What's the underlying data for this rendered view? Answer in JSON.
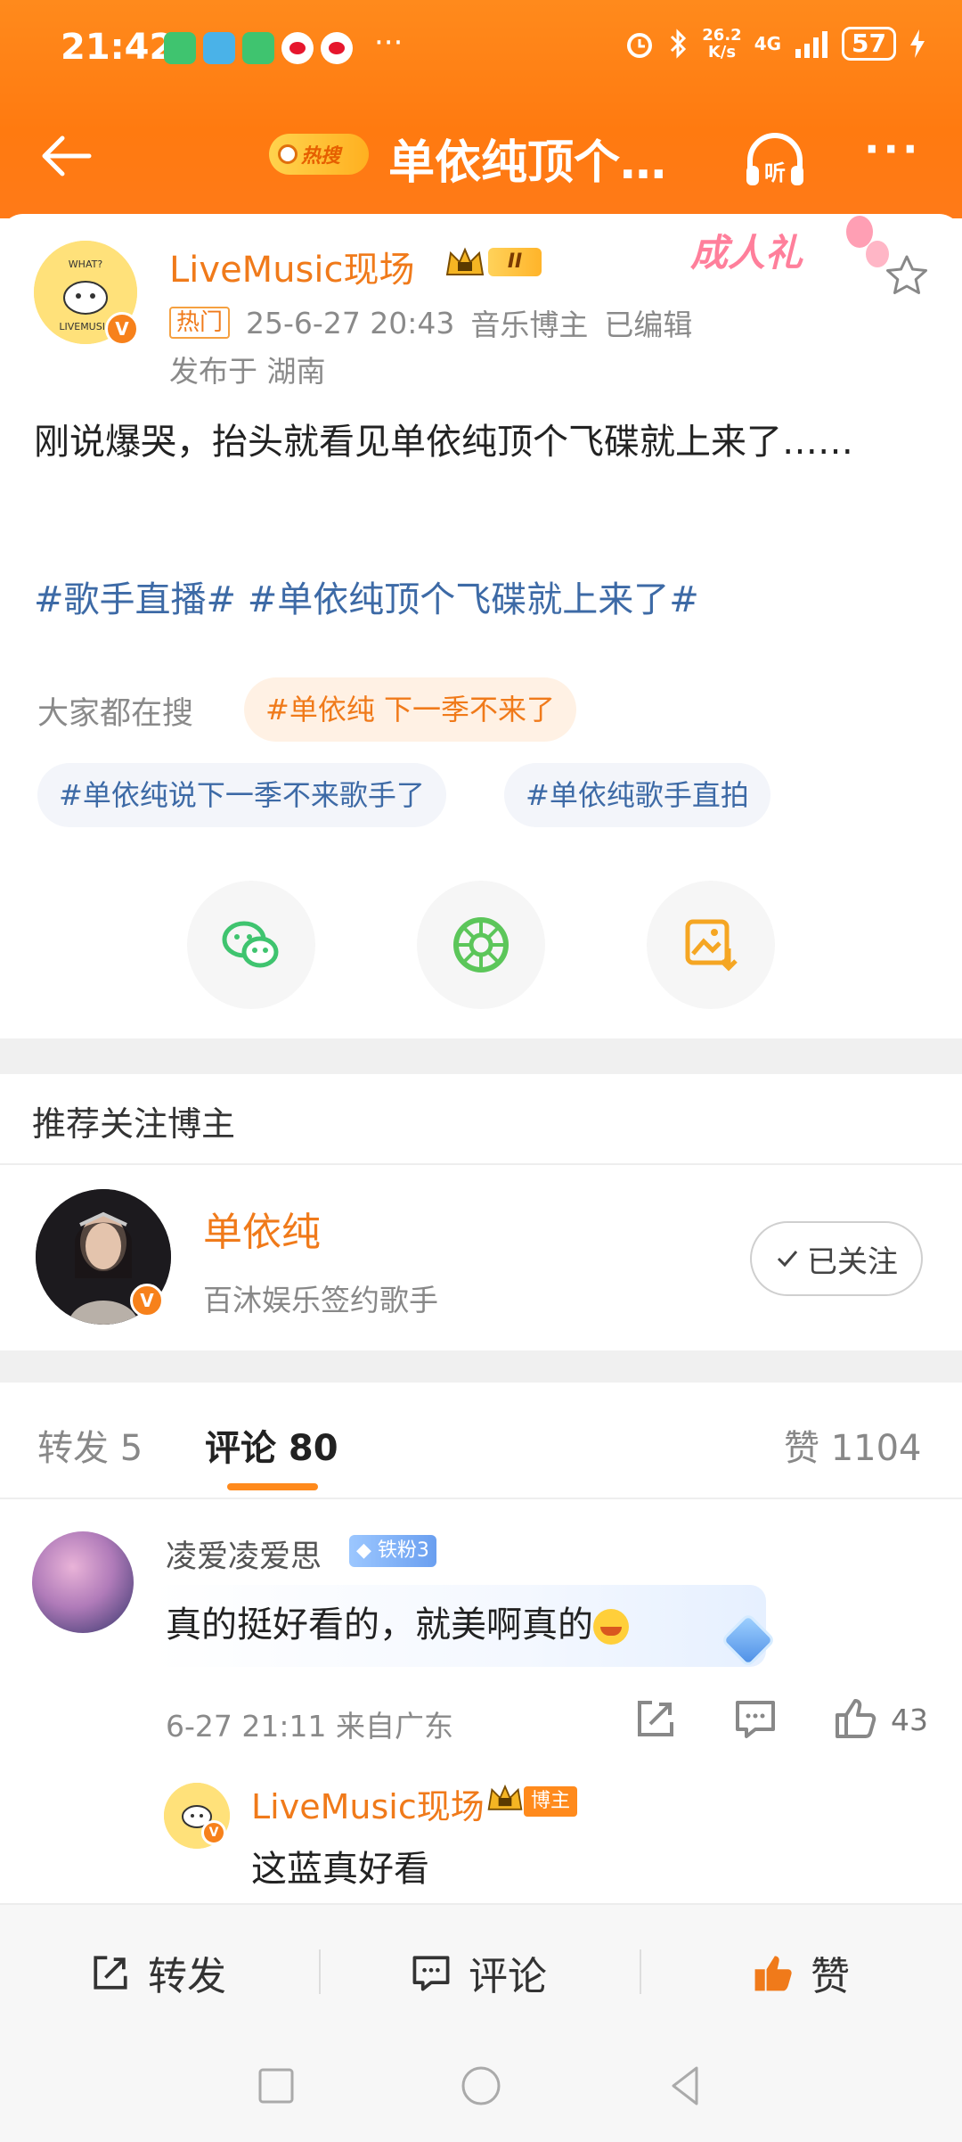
{
  "status_bar": {
    "time": "21:42",
    "more": "···",
    "net_speed_value": "26.2",
    "net_speed_unit": "K/s",
    "signal": "4G",
    "battery": "57"
  },
  "header": {
    "hot_search_tag": "热搜",
    "title": "单依纯顶个…",
    "listen_label": "听",
    "more": "···"
  },
  "post": {
    "author": "LiveMusic现场",
    "level": "II",
    "gift_tag": "成人礼",
    "hot_tag": "热门",
    "time": "25-6-27 20:43",
    "role": "音乐博主",
    "edited": "已编辑",
    "location": "发布于 湖南",
    "text": "刚说爆哭，抬头就看见单依纯顶个飞碟就上来了……",
    "topics": "#歌手直播# #单依纯顶个飞碟就上来了#",
    "search_label": "大家都在搜",
    "search_chips": [
      "#单依纯 下一季不来了",
      "#单依纯说下一季不来歌手了",
      "#单依纯歌手直拍"
    ],
    "avatar_text": "LIVEMUSIC",
    "avatar_text_top": "WHAT?"
  },
  "recommend": {
    "title": "推荐关注博主",
    "name": "单依纯",
    "desc": "百沐娱乐签约歌手",
    "follow_label": "已关注"
  },
  "tabs": {
    "repost": "转发 5",
    "comment": "评论 80",
    "likes": "赞 1104"
  },
  "comments": [
    {
      "name": "凌爱凌爱思",
      "badge": "铁粉3",
      "text": "真的挺好看的，就美啊真的",
      "meta": "6-27 21:11 来自广东",
      "likes": "43",
      "reply": {
        "name": "LiveMusic现场",
        "tag": "博主",
        "text": "这蓝真好看"
      }
    }
  ],
  "action_bar": {
    "repost": "转发",
    "comment": "评论",
    "like": "赞"
  },
  "colors": {
    "header_orange": "#ff7a10",
    "accent_orange": "#f07a1a",
    "topic_blue": "#3d6aa6",
    "wechat_green": "#3fc46f",
    "like_orange": "#f07a1a"
  }
}
